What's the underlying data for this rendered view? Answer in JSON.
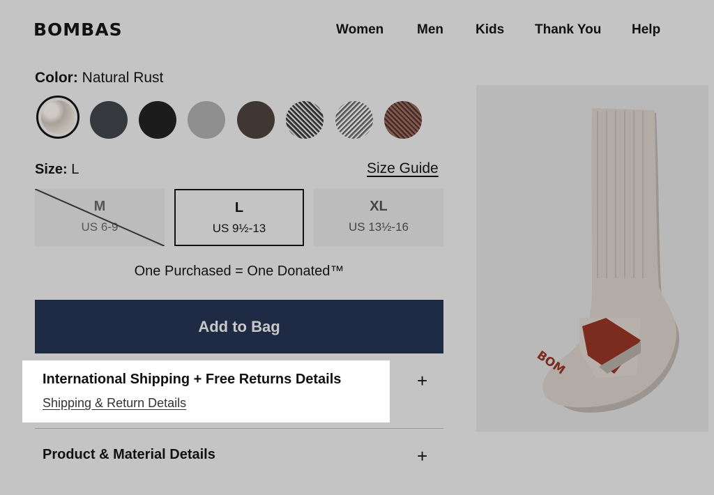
{
  "header": {
    "logo": "BOMBAS",
    "nav": [
      "Women",
      "Men",
      "Kids",
      "Thank You",
      "Help"
    ]
  },
  "color": {
    "label": "Color:",
    "value": "Natural Rust",
    "swatches": [
      {
        "name": "natural-rust",
        "color": "#b9b2ab",
        "selected": true
      },
      {
        "name": "charcoal",
        "color": "#35383d"
      },
      {
        "name": "black",
        "color": "#1c1c1c"
      },
      {
        "name": "grey",
        "color": "#8e8e8e"
      },
      {
        "name": "brown",
        "color": "#403632"
      },
      {
        "name": "black-white-marl",
        "color": "#6b6b6b"
      },
      {
        "name": "grey-marl",
        "color": "#888888"
      },
      {
        "name": "rust-marl",
        "color": "#5a3f38"
      }
    ]
  },
  "size": {
    "label": "Size:",
    "value": "L",
    "guide": "Size Guide",
    "options": [
      {
        "size": "M",
        "us": "US 6-9",
        "available": false
      },
      {
        "size": "L",
        "us": "US 9½-13",
        "selected": true
      },
      {
        "size": "XL",
        "us": "US 13½-16"
      }
    ]
  },
  "donate_text": "One Purchased = One Donated™",
  "add_to_bag": "Add to Bag",
  "accordion": [
    {
      "title": "International Shipping + Free Returns Details",
      "link": "Shipping & Return Details"
    },
    {
      "title": "Product & Material Details"
    }
  ],
  "plus": "+",
  "sock_brand": "BOM"
}
